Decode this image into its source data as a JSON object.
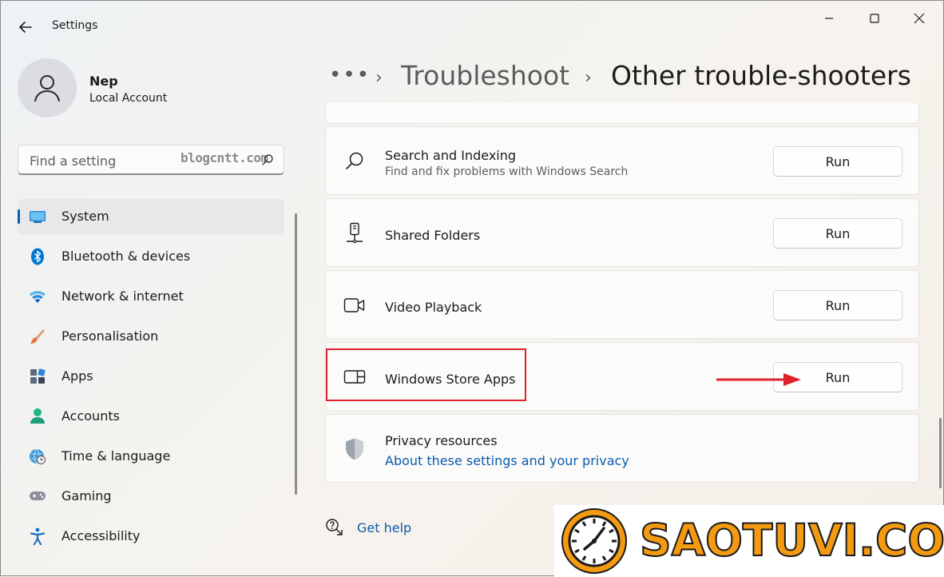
{
  "app": {
    "title": "Settings"
  },
  "account": {
    "name": "Nep",
    "type": "Local Account"
  },
  "search": {
    "placeholder": "Find a setting",
    "watermark": "blogcntt.com"
  },
  "nav": {
    "items": [
      {
        "label": "System",
        "icon": "system-icon",
        "active": true
      },
      {
        "label": "Bluetooth & devices",
        "icon": "bluetooth-icon"
      },
      {
        "label": "Network & internet",
        "icon": "wifi-icon"
      },
      {
        "label": "Personalisation",
        "icon": "brush-icon"
      },
      {
        "label": "Apps",
        "icon": "apps-icon"
      },
      {
        "label": "Accounts",
        "icon": "accounts-icon"
      },
      {
        "label": "Time & language",
        "icon": "globe-clock-icon"
      },
      {
        "label": "Gaming",
        "icon": "gamepad-icon"
      },
      {
        "label": "Accessibility",
        "icon": "accessibility-icon"
      }
    ]
  },
  "breadcrumb": {
    "dots": "•••",
    "parent": "Troubleshoot",
    "current": "Other trouble-shooters",
    "sep": "›"
  },
  "troubleshooters": [
    {
      "title": "Search and Indexing",
      "subtitle": "Find and fix problems with Windows Search",
      "icon": "search-icon",
      "button": "Run"
    },
    {
      "title": "Shared Folders",
      "icon": "shared-folders-icon",
      "button": "Run"
    },
    {
      "title": "Video Playback",
      "icon": "video-camera-icon",
      "button": "Run"
    },
    {
      "title": "Windows Store Apps",
      "icon": "store-apps-icon",
      "button": "Run"
    }
  ],
  "privacy": {
    "title": "Privacy resources",
    "link": "About these settings and your privacy",
    "icon": "shield-icon"
  },
  "help": {
    "label": "Get help",
    "icon": "help-chat-icon"
  },
  "logo": {
    "text": "SAOTUVI.COM",
    "icon": "clock-logo-icon"
  },
  "colors": {
    "accent": "#005fb8",
    "link": "#0b5cad",
    "highlight": "#e0222a",
    "logo_orange": "#f39a12"
  }
}
